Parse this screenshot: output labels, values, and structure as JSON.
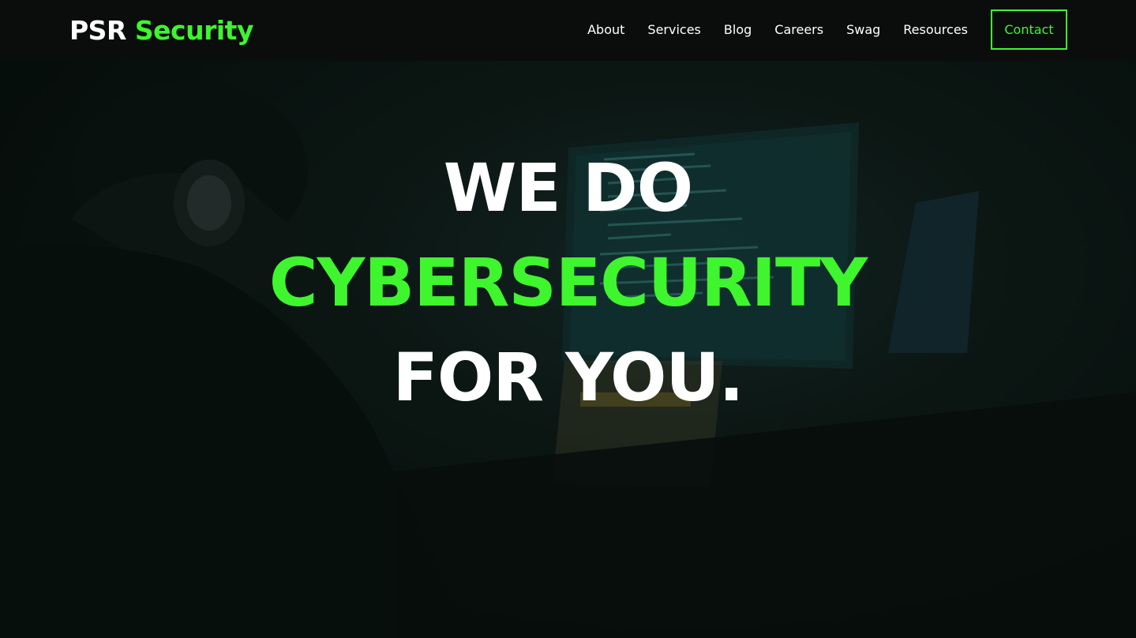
{
  "brand": {
    "name_part1": "PSR",
    "name_part2": "Security"
  },
  "nav": {
    "items": [
      {
        "label": "About"
      },
      {
        "label": "Services"
      },
      {
        "label": "Blog"
      },
      {
        "label": "Careers"
      },
      {
        "label": "Swag"
      },
      {
        "label": "Resources"
      }
    ],
    "contact_label": "Contact"
  },
  "hero": {
    "line1": "WE DO",
    "line2": "CYBERSECURITY",
    "line3": "FOR YOU."
  },
  "colors": {
    "accent": "#3ef52e",
    "navbar_bg": "#0b0d0c",
    "hero_bg": "#0e1a16"
  }
}
